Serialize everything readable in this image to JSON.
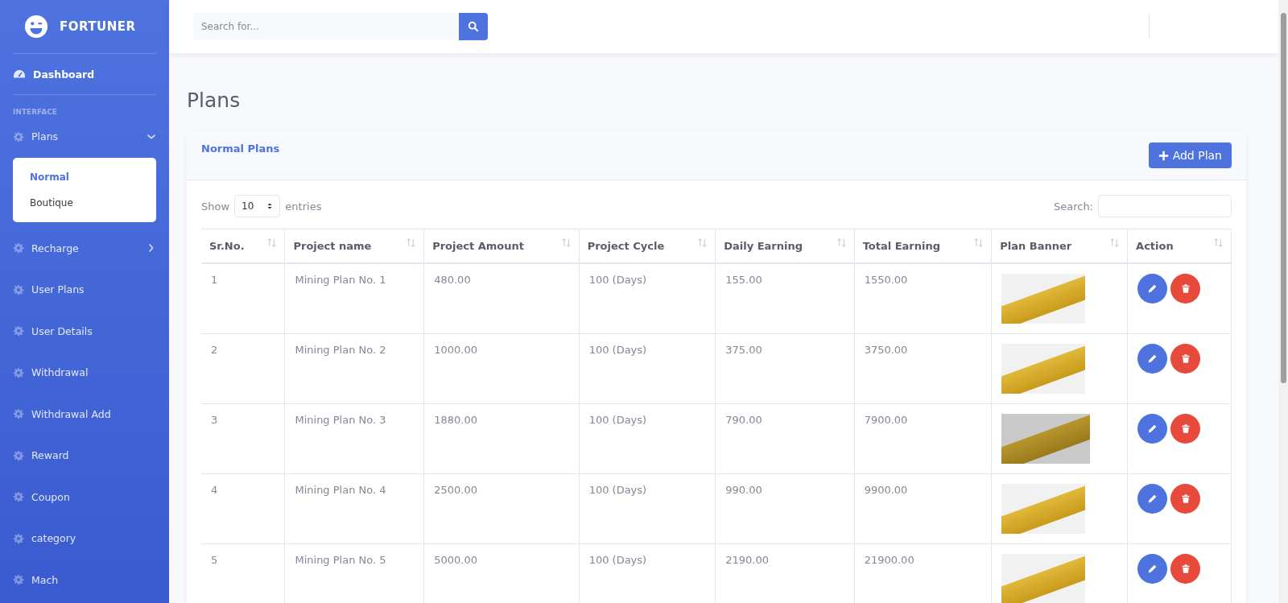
{
  "brand": {
    "name": "FORTUNER"
  },
  "sidebar": {
    "dashboard": "Dashboard",
    "section_heading": "INTERFACE",
    "items": [
      {
        "label": "Plans",
        "kind": "submenu",
        "expanded": true,
        "children": [
          {
            "label": "Normal",
            "selected": true
          },
          {
            "label": "Boutique",
            "selected": false
          }
        ]
      },
      {
        "label": "Recharge",
        "kind": "submenu",
        "expanded": false
      },
      {
        "label": "User Plans",
        "kind": "link"
      },
      {
        "label": "User Details",
        "kind": "link"
      },
      {
        "label": "Withdrawal",
        "kind": "link"
      },
      {
        "label": "Withdrawal Add",
        "kind": "link"
      },
      {
        "label": "Reward",
        "kind": "link"
      },
      {
        "label": "Coupon",
        "kind": "link"
      },
      {
        "label": "category",
        "kind": "link"
      },
      {
        "label": "Mach",
        "kind": "link"
      }
    ]
  },
  "topbar": {
    "search": {
      "placeholder": "Search for..."
    }
  },
  "page": {
    "title": "Plans"
  },
  "card": {
    "title": "Normal Plans",
    "add_button": "Add Plan",
    "length": {
      "show": "Show",
      "value": "10",
      "entries": "entries"
    },
    "filter": {
      "label": "Search:"
    },
    "table": {
      "columns": [
        "Sr.No.",
        "Project name",
        "Project Amount",
        "Project Cycle",
        "Daily Earning",
        "Total Earning",
        "Plan Banner",
        "Action"
      ],
      "rows": [
        {
          "cells": [
            "1",
            "Mining Plan No. 1",
            "480.00",
            "100 (Days)",
            "155.00",
            "1550.00"
          ]
        },
        {
          "cells": [
            "2",
            "Mining Plan No. 2",
            "1000.00",
            "100 (Days)",
            "375.00",
            "3750.00"
          ]
        },
        {
          "cells": [
            "3",
            "Mining Plan No. 3",
            "1880.00",
            "100 (Days)",
            "790.00",
            "7900.00"
          ]
        },
        {
          "cells": [
            "4",
            "Mining Plan No. 4",
            "2500.00",
            "100 (Days)",
            "990.00",
            "9900.00"
          ]
        },
        {
          "cells": [
            "5",
            "Mining Plan No. 5",
            "5000.00",
            "100 (Days)",
            "2190.00",
            "21900.00"
          ]
        }
      ]
    }
  }
}
